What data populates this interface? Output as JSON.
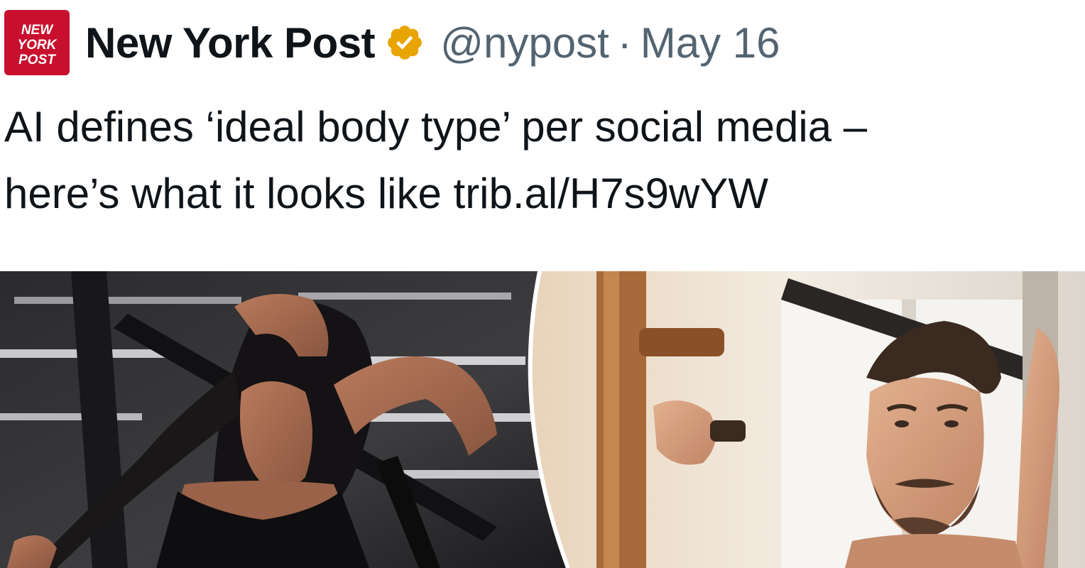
{
  "tweet": {
    "author": {
      "name": "New York Post",
      "handle": "@nypost",
      "avatar_logo_lines": [
        "NEW",
        "YORK",
        "POST"
      ],
      "verified_icon": "gold-verified-badge-icon",
      "brand_color": "#c8102e"
    },
    "separator": "·",
    "date": "May 16",
    "text_lines": [
      "AI defines ‘ideal body type’ per social media –",
      "here’s what it looks like "
    ],
    "link_text": "trib.al/H7s9wYW",
    "media": {
      "panels": [
        {
          "description_icon": "woman-in-gym-photo"
        },
        {
          "description_icon": "man-in-gym-photo"
        }
      ]
    }
  },
  "colors": {
    "text_primary": "#0f1419",
    "text_secondary": "#536471",
    "verified_gold": "#e8a400",
    "background": "#ffffff"
  }
}
